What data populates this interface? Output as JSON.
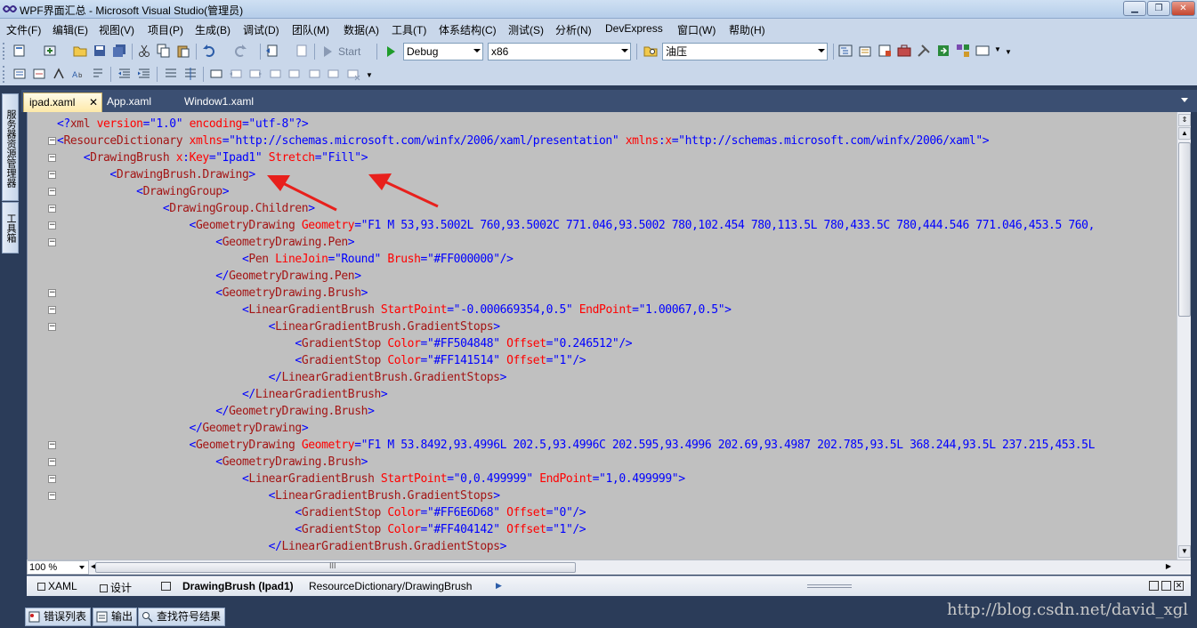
{
  "window": {
    "title": "WPF界面汇总 - Microsoft Visual Studio(管理员)"
  },
  "menu": [
    "文件(F)",
    "编辑(E)",
    "视图(V)",
    "项目(P)",
    "生成(B)",
    "调试(D)",
    "团队(M)",
    "数据(A)",
    "工具(T)",
    "体系结构(C)",
    "测试(S)",
    "分析(N)",
    "DevExpress",
    "窗口(W)",
    "帮助(H)"
  ],
  "toolbar": {
    "start_label": "Start",
    "config": "Debug",
    "platform": "x86",
    "find": "油压"
  },
  "left_panel": {
    "server_explorer": "服务器资源管理器",
    "toolbox": "工具箱"
  },
  "tabs": [
    "ipad.xaml",
    "App.xaml",
    "Window1.xaml"
  ],
  "zoom": "100 %",
  "hscroll_thumb": "III",
  "status": {
    "xaml": "XAML",
    "design": "设计",
    "element": "DrawingBrush (Ipad1)",
    "path": "ResourceDictionary/DrawingBrush"
  },
  "bottom_tabs": [
    "错误列表",
    "输出",
    "查找符号结果"
  ],
  "watermark": "http://blog.csdn.net/david_xgl"
}
